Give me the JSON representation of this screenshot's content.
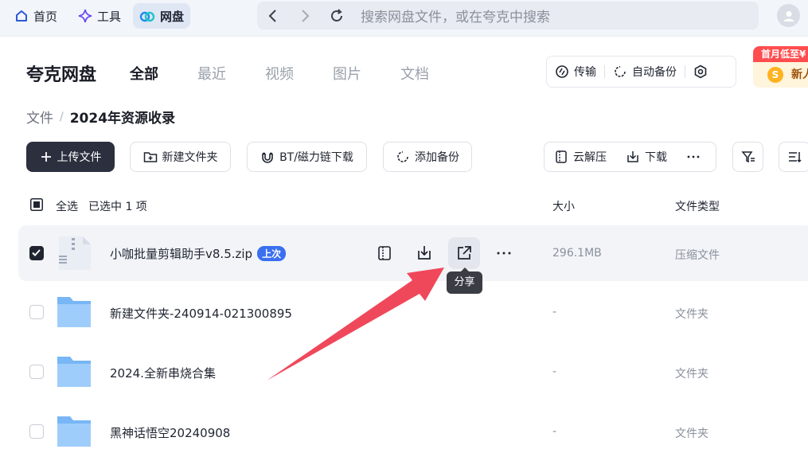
{
  "topbar": {
    "nav": [
      {
        "label": "首页",
        "icon": "home-icon"
      },
      {
        "label": "工具",
        "icon": "sparkle-icon"
      },
      {
        "label": "网盘",
        "icon": "cloud-icon"
      }
    ],
    "search_placeholder": "搜索网盘文件，或在夸克中搜索"
  },
  "header": {
    "brand": "夸克网盘",
    "tabs": [
      "全部",
      "最近",
      "视频",
      "图片",
      "文档"
    ],
    "tools": {
      "transfer": "传输",
      "backup": "自动备份"
    },
    "promo": {
      "top": "首月低至¥",
      "sub": "新人"
    }
  },
  "breadcrumb": {
    "root": "文件",
    "current": "2024年资源收录"
  },
  "actions": {
    "upload": "上传文件",
    "new_folder": "新建文件夹",
    "bt": "BT/磁力链下载",
    "add_backup": "添加备份",
    "unzip": "云解压",
    "download": "下载"
  },
  "table": {
    "select_all": "全选",
    "selected_count": "已选中 1 项",
    "col_size": "大小",
    "col_type": "文件类型",
    "rows": [
      {
        "name": "小咖批量剪辑助手v8.5.zip",
        "badge": "上次",
        "size": "296.1MB",
        "type": "压缩文件",
        "selected": true
      },
      {
        "name": "新建文件夹-240914-021300895",
        "size": "-",
        "type": "文件夹"
      },
      {
        "name": "2024.全新串烧合集",
        "size": "-",
        "type": "文件夹"
      },
      {
        "name": "黑神话悟空20240908",
        "size": "-",
        "type": "文件夹"
      }
    ]
  },
  "tooltip": "分享",
  "colors": {
    "accent": "#3a6ff0",
    "dark": "#2c2f3e",
    "arrow": "#f0485b"
  }
}
